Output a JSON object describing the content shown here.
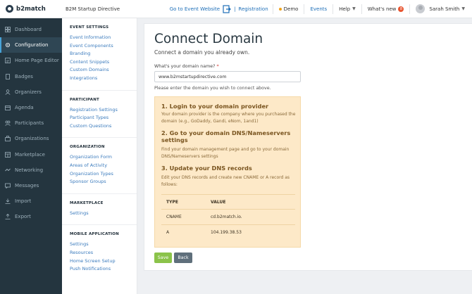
{
  "topbar": {
    "brand": "b2match",
    "event_name": "B2M Startup Directive",
    "go_to_event": "Go to Event Website",
    "registration": "Registration",
    "demo": "Demo",
    "events": "Events",
    "help": "Help",
    "whats_new": "What's new",
    "whats_new_count": "8",
    "user_name": "Sarah Smith"
  },
  "sidebar": {
    "items": [
      {
        "label": "Dashboard",
        "icon": "dashboard-icon"
      },
      {
        "label": "Configuration",
        "icon": "gear-icon"
      },
      {
        "label": "Home Page Editor",
        "icon": "home-editor-icon"
      },
      {
        "label": "Badges",
        "icon": "badge-icon"
      },
      {
        "label": "Organizers",
        "icon": "organizers-icon"
      },
      {
        "label": "Agenda",
        "icon": "agenda-icon"
      },
      {
        "label": "Participants",
        "icon": "participants-icon"
      },
      {
        "label": "Organizations",
        "icon": "organizations-icon"
      },
      {
        "label": "Marketplace",
        "icon": "marketplace-icon"
      },
      {
        "label": "Networking",
        "icon": "networking-icon"
      },
      {
        "label": "Messages",
        "icon": "messages-icon"
      },
      {
        "label": "Import",
        "icon": "import-icon"
      },
      {
        "label": "Export",
        "icon": "export-icon"
      }
    ],
    "active": "Configuration"
  },
  "settings": {
    "sections": [
      {
        "title": "EVENT SETTINGS",
        "links": [
          "Event Information",
          "Event Components",
          "Branding",
          "Content Snippets",
          "Custom Domains",
          "Integrations"
        ]
      },
      {
        "title": "PARTICIPANT",
        "links": [
          "Registration Settings",
          "Participant Types",
          "Custom Questions"
        ]
      },
      {
        "title": "ORGANIZATION",
        "links": [
          "Organization Form",
          "Areas of Activity",
          "Organization Types",
          "Sponsor Groups"
        ]
      },
      {
        "title": "MARKETPLACE",
        "links": [
          "Settings"
        ]
      },
      {
        "title": "MOBILE APPLICATION",
        "links": [
          "Settings",
          "Resources",
          "Home Screen Setup",
          "Push Notifications"
        ]
      }
    ]
  },
  "main": {
    "title": "Connect Domain",
    "subtitle": "Connect a domain you already own.",
    "field_label": "What's your domain name?",
    "required_mark": "*",
    "domain_value": "www.b2mstartupdirective.com",
    "helper": "Please enter the domain you wish to connect above.",
    "steps": [
      {
        "title": "1. Login to your domain provider",
        "body": "Your domain provider is the company where you purchased the domain (e.g., GoDaddy, Gandi, eNom, 1and1)"
      },
      {
        "title": "2. Go to your domain DNS/Nameservers settings",
        "body": "Find your domain management page and go to your domain DNS/Nameservers settings"
      },
      {
        "title": "3. Update your DNS records",
        "body": "Edit your DNS records and create new CNAME or A record as follows:"
      }
    ],
    "table": {
      "headers": [
        "TYPE",
        "VALUE"
      ],
      "rows": [
        [
          "CNAME",
          "cd.b2match.io."
        ],
        [
          "A",
          "104.199.38.53"
        ]
      ]
    },
    "save_label": "Save",
    "back_label": "Back"
  },
  "colors": {
    "sidebar_bg": "#24353f",
    "accent_link": "#1e6fb8",
    "save": "#8bc34a",
    "back": "#5f6f7b",
    "instructions_bg": "#fde9c8"
  }
}
